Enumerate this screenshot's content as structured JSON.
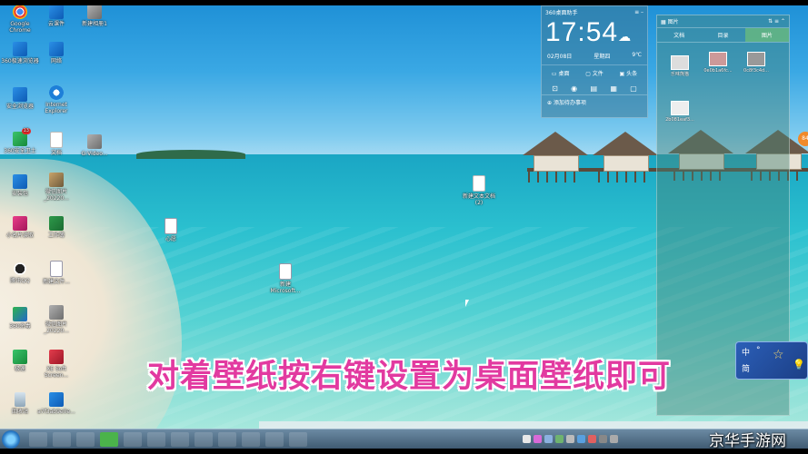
{
  "desktop_icons": [
    {
      "label": "Google Chrome",
      "icon": "chrome-icon"
    },
    {
      "label": "360极速浏览器",
      "icon": "browser-icon"
    },
    {
      "label": "安全浏览器",
      "icon": "safe-browser-icon"
    },
    {
      "label": "360安全卫士",
      "icon": "security-icon",
      "badge": "13"
    },
    {
      "label": "安装包",
      "icon": "installer-icon"
    },
    {
      "label": "小名片读取",
      "icon": "app-icon"
    },
    {
      "label": "腾讯QQ",
      "icon": "qq-icon"
    },
    {
      "label": "360杀毒",
      "icon": "antivirus-icon"
    },
    {
      "label": "极速",
      "icon": "speed-icon"
    },
    {
      "label": "回收站",
      "icon": "recycle-bin-icon"
    },
    {
      "label": "云课件",
      "icon": "cloud-icon"
    },
    {
      "label": "网络",
      "icon": "network-icon"
    },
    {
      "label": "Internet Explorer",
      "icon": "ie-icon"
    },
    {
      "label": "文档",
      "icon": "document-icon"
    },
    {
      "label": "微信图片_20220...",
      "icon": "photo-icon"
    },
    {
      "label": "工作簿",
      "icon": "excel-icon"
    },
    {
      "label": "新建文件...",
      "icon": "word-icon"
    },
    {
      "label": "微信图片_20220...",
      "icon": "photo-icon"
    },
    {
      "label": "XE Soft Screen...",
      "icon": "screen-icon"
    },
    {
      "label": "a7f3ab9e0e...",
      "icon": "image-icon"
    },
    {
      "label": "新建相册1",
      "icon": "album-icon"
    },
    {
      "label": "G:Video...",
      "icon": "video-icon"
    },
    {
      "label": "心愿",
      "icon": "word-icon"
    },
    {
      "label": "新建 Microsoft...",
      "icon": "word-icon"
    },
    {
      "label": "新建文本文档 (2)",
      "icon": "text-icon"
    }
  ],
  "assistant": {
    "title": "360桌面助手",
    "time": "17:54",
    "date": "02月08日",
    "weekday": "星期四",
    "temp": "9℃",
    "quick": [
      "桌面",
      "文件",
      "头条"
    ],
    "add_label": "添加待办事项"
  },
  "fence": {
    "title": "图片",
    "tabs": [
      "文档",
      "目录",
      "图片"
    ],
    "items": [
      {
        "label": "乐味熊猫"
      },
      {
        "label": "0e0b1a6fc..."
      },
      {
        "label": "0c8f3c4d..."
      },
      {
        "label": "2b081eaf3..."
      }
    ]
  },
  "caption": "对着壁纸按右键设置为桌面壁纸即可",
  "ime": {
    "mode": "中",
    "punct": "简"
  },
  "notification_badge": "84",
  "watermark": "京华手游网",
  "colors": {
    "caption": "#e23aa0",
    "taskbar": "#3e5970",
    "accent": "#2b5fb8"
  }
}
